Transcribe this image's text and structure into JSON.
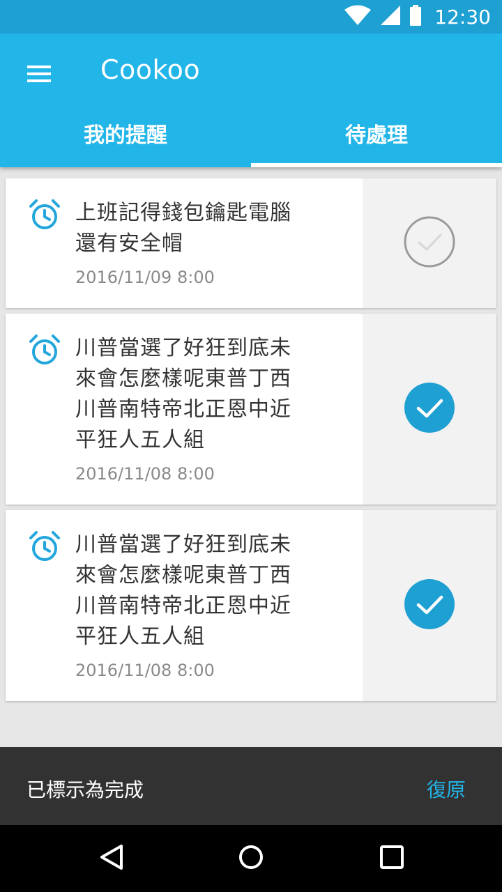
{
  "status_bar": {
    "time": "12:30",
    "icons": [
      "wifi-icon",
      "signal-icon",
      "battery-icon"
    ]
  },
  "app_bar": {
    "title": "Cookoo",
    "menu_icon": "menu-icon",
    "tabs": [
      {
        "label": "我的提醒",
        "active": false
      },
      {
        "label": "待處理",
        "active": true
      }
    ]
  },
  "reminders": [
    {
      "text": "上班記得錢包鑰匙電腦還有安全帽",
      "date": "2016/11/09 8:00",
      "done": false
    },
    {
      "text": "川普當選了好狂到底未來會怎麼樣呢東普丁西川普南特帝北正恩中近平狂人五人組",
      "date": "2016/11/08 8:00",
      "done": true
    },
    {
      "text": "川普當選了好狂到底未來會怎麼樣呢東普丁西川普南特帝北正恩中近平狂人五人組",
      "date": "2016/11/08 8:00",
      "done": true
    }
  ],
  "snackbar": {
    "message": "已標示為完成",
    "action": "復原"
  },
  "nav_bar": {
    "buttons": [
      "back-icon",
      "home-icon",
      "recents-icon"
    ]
  },
  "colors": {
    "primary": "#22b5e8",
    "primary_dark": "#1fa0d3",
    "check_done": "#1fa0d3",
    "snackbar": "#323232",
    "action_text": "#22b5e8"
  }
}
